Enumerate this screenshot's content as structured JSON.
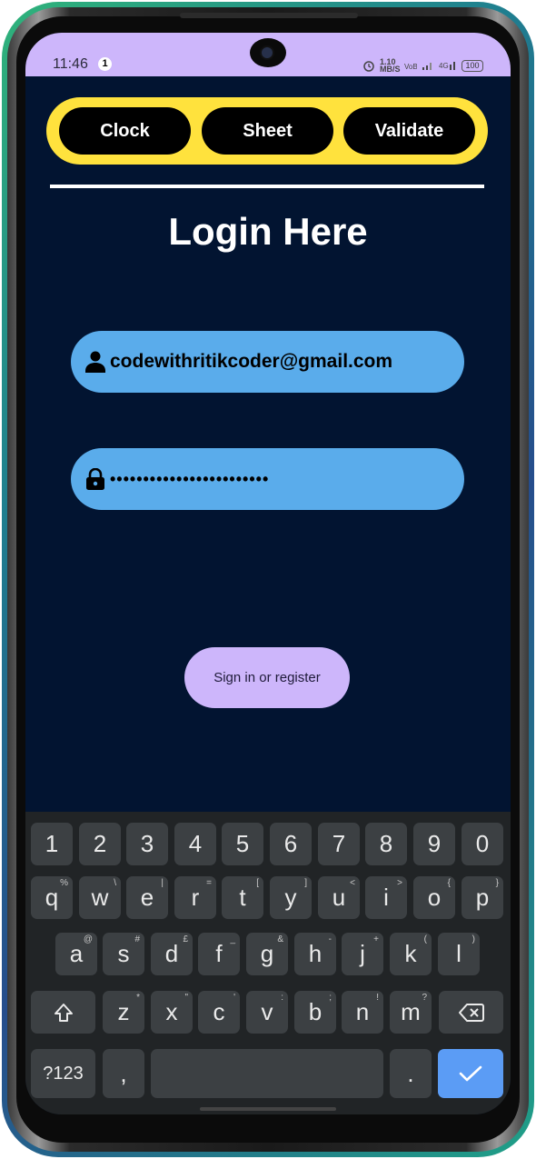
{
  "status_bar": {
    "time": "11:46",
    "notification_count": "1",
    "network_speed": "1.10 MB/S",
    "battery": "100"
  },
  "nav": {
    "buttons": [
      "Clock",
      "Sheet",
      "Validate"
    ]
  },
  "page": {
    "title": "Login Here"
  },
  "form": {
    "email_value": "codewithritikcoder@gmail.com",
    "password_value": "••••••••••••••••••••••••",
    "submit_label": "Sign in or register"
  },
  "keyboard": {
    "numbers": [
      "1",
      "2",
      "3",
      "4",
      "5",
      "6",
      "7",
      "8",
      "9",
      "0"
    ],
    "row1": [
      "q",
      "w",
      "e",
      "r",
      "t",
      "y",
      "u",
      "i",
      "o",
      "p"
    ],
    "row1_hints": [
      "%",
      "\\",
      "|",
      "=",
      "[",
      "]",
      "<",
      ">",
      "{",
      "}"
    ],
    "row2": [
      "a",
      "s",
      "d",
      "f",
      "g",
      "h",
      "j",
      "k",
      "l"
    ],
    "row2_hints": [
      "@",
      "#",
      "£",
      "_",
      "&",
      "-",
      "+",
      "(",
      ")"
    ],
    "row3": [
      "z",
      "x",
      "c",
      "v",
      "b",
      "n",
      "m"
    ],
    "row3_hints": [
      "*",
      "\"",
      "'",
      ":",
      ";",
      "!",
      "?"
    ],
    "symbols_label": "?123",
    "comma": ",",
    "period": ".",
    "icons": {
      "shift": "shift-icon",
      "backspace": "backspace-icon",
      "enter": "check-icon"
    }
  },
  "colors": {
    "background": "#021431",
    "nav_bg": "#ffe23d",
    "field_bg": "#5aaceb",
    "button_bg": "#cdb6fb",
    "keyboard_bg": "#212426",
    "key_bg": "#3c4043",
    "enter_key_bg": "#5b9cf5"
  }
}
